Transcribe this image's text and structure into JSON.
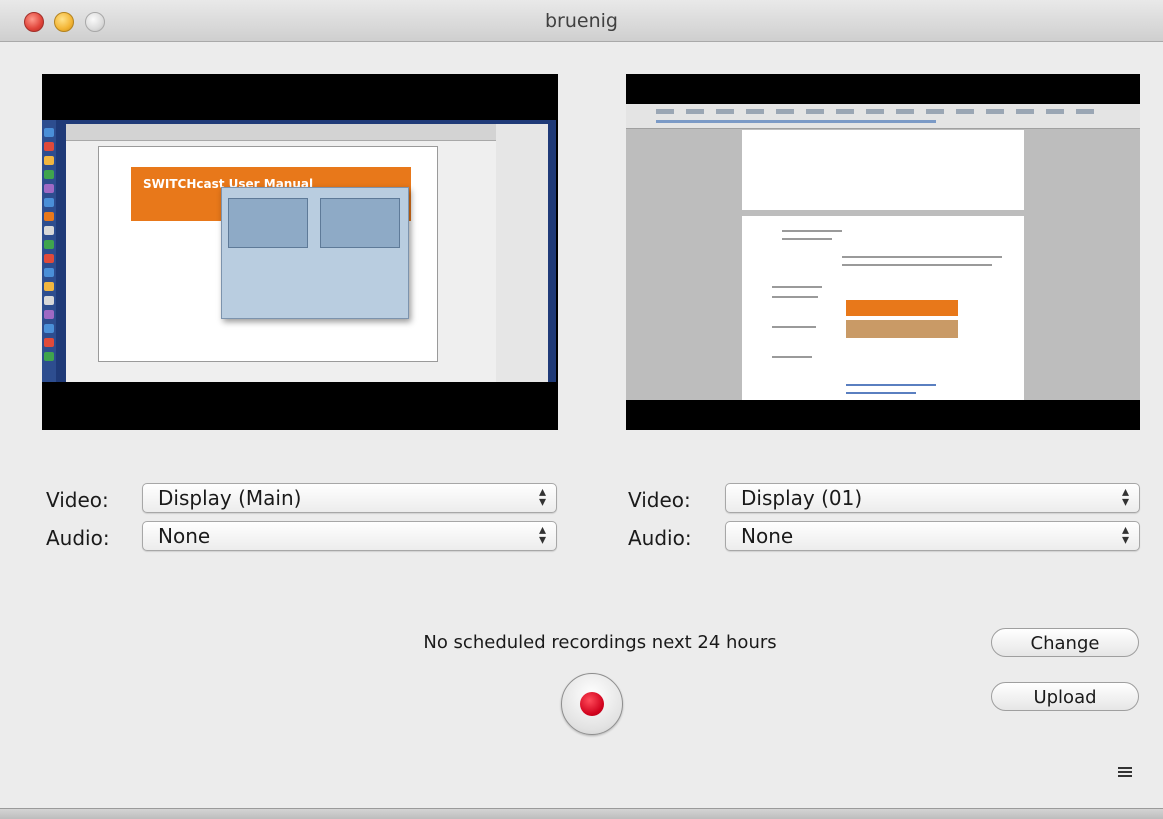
{
  "window": {
    "title": "bruenig"
  },
  "left_source": {
    "video_label": "Video:",
    "video_value": "Display (Main)",
    "audio_label": "Audio:",
    "audio_value": "None",
    "banner_text": "SWITCHcast User Manual"
  },
  "right_source": {
    "video_label": "Video:",
    "video_value": "Display (01)",
    "audio_label": "Audio:",
    "audio_value": "None"
  },
  "status": {
    "message": "No scheduled recordings next 24 hours"
  },
  "buttons": {
    "change_label": "Change",
    "upload_label": "Upload"
  },
  "icons": {
    "close": "close-icon",
    "minimize": "minimize-icon",
    "zoom": "zoom-icon",
    "record": "record-icon",
    "select_arrows": "select-arrows-icon",
    "menu": "menu-icon"
  },
  "colors": {
    "record_red": "#d1021d",
    "banner_orange": "#e8781a"
  }
}
